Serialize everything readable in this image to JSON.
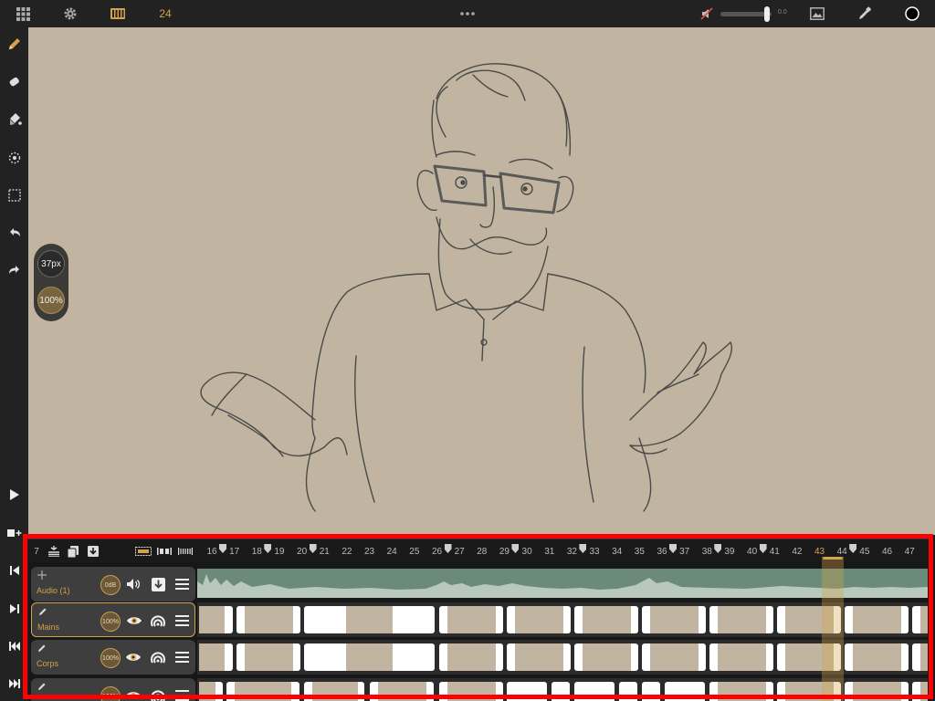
{
  "topbar": {
    "fps": "24",
    "volume_value": "0.0",
    "icons": [
      "grid-icon",
      "gear-icon",
      "film-strip-icon",
      "more-dots-icon",
      "mute-icon",
      "image-icon",
      "eyedropper-icon",
      "color-swatch-icon"
    ]
  },
  "toolbar": {
    "tools": [
      "pencil-icon",
      "eraser-icon",
      "paint-bucket-icon",
      "lasso-icon",
      "marquee-select-icon",
      "undo-icon",
      "redo-icon"
    ],
    "brush_size": "37px",
    "brush_opacity": "100%",
    "controls": [
      "play-icon",
      "add-frame-icon",
      "jump-start-icon",
      "next-frame-icon",
      "prev-frame-icon",
      "jump-end-icon"
    ]
  },
  "timeline": {
    "start_frame": "7",
    "current_frame": "43",
    "frame_numbers": [
      "16",
      "17",
      "18",
      "19",
      "20",
      "21",
      "22",
      "23",
      "24",
      "25",
      "26",
      "27",
      "28",
      "29",
      "30",
      "31",
      "32",
      "33",
      "34",
      "35",
      "36",
      "37",
      "38",
      "39",
      "40",
      "41",
      "42",
      "43",
      "44",
      "45",
      "46",
      "47"
    ],
    "tracks": [
      {
        "name": "Audio (1)",
        "level": "0dB"
      },
      {
        "name": "Mains",
        "opacity": "100%"
      },
      {
        "name": "Corps",
        "opacity": "100%"
      },
      {
        "name": "",
        "opacity": "100%"
      }
    ]
  },
  "colors": {
    "accent": "#d4a24a",
    "canvas": "#c1b5a1",
    "audio_wave": "#6b8a7a",
    "frame_marker": "#ff0000"
  }
}
